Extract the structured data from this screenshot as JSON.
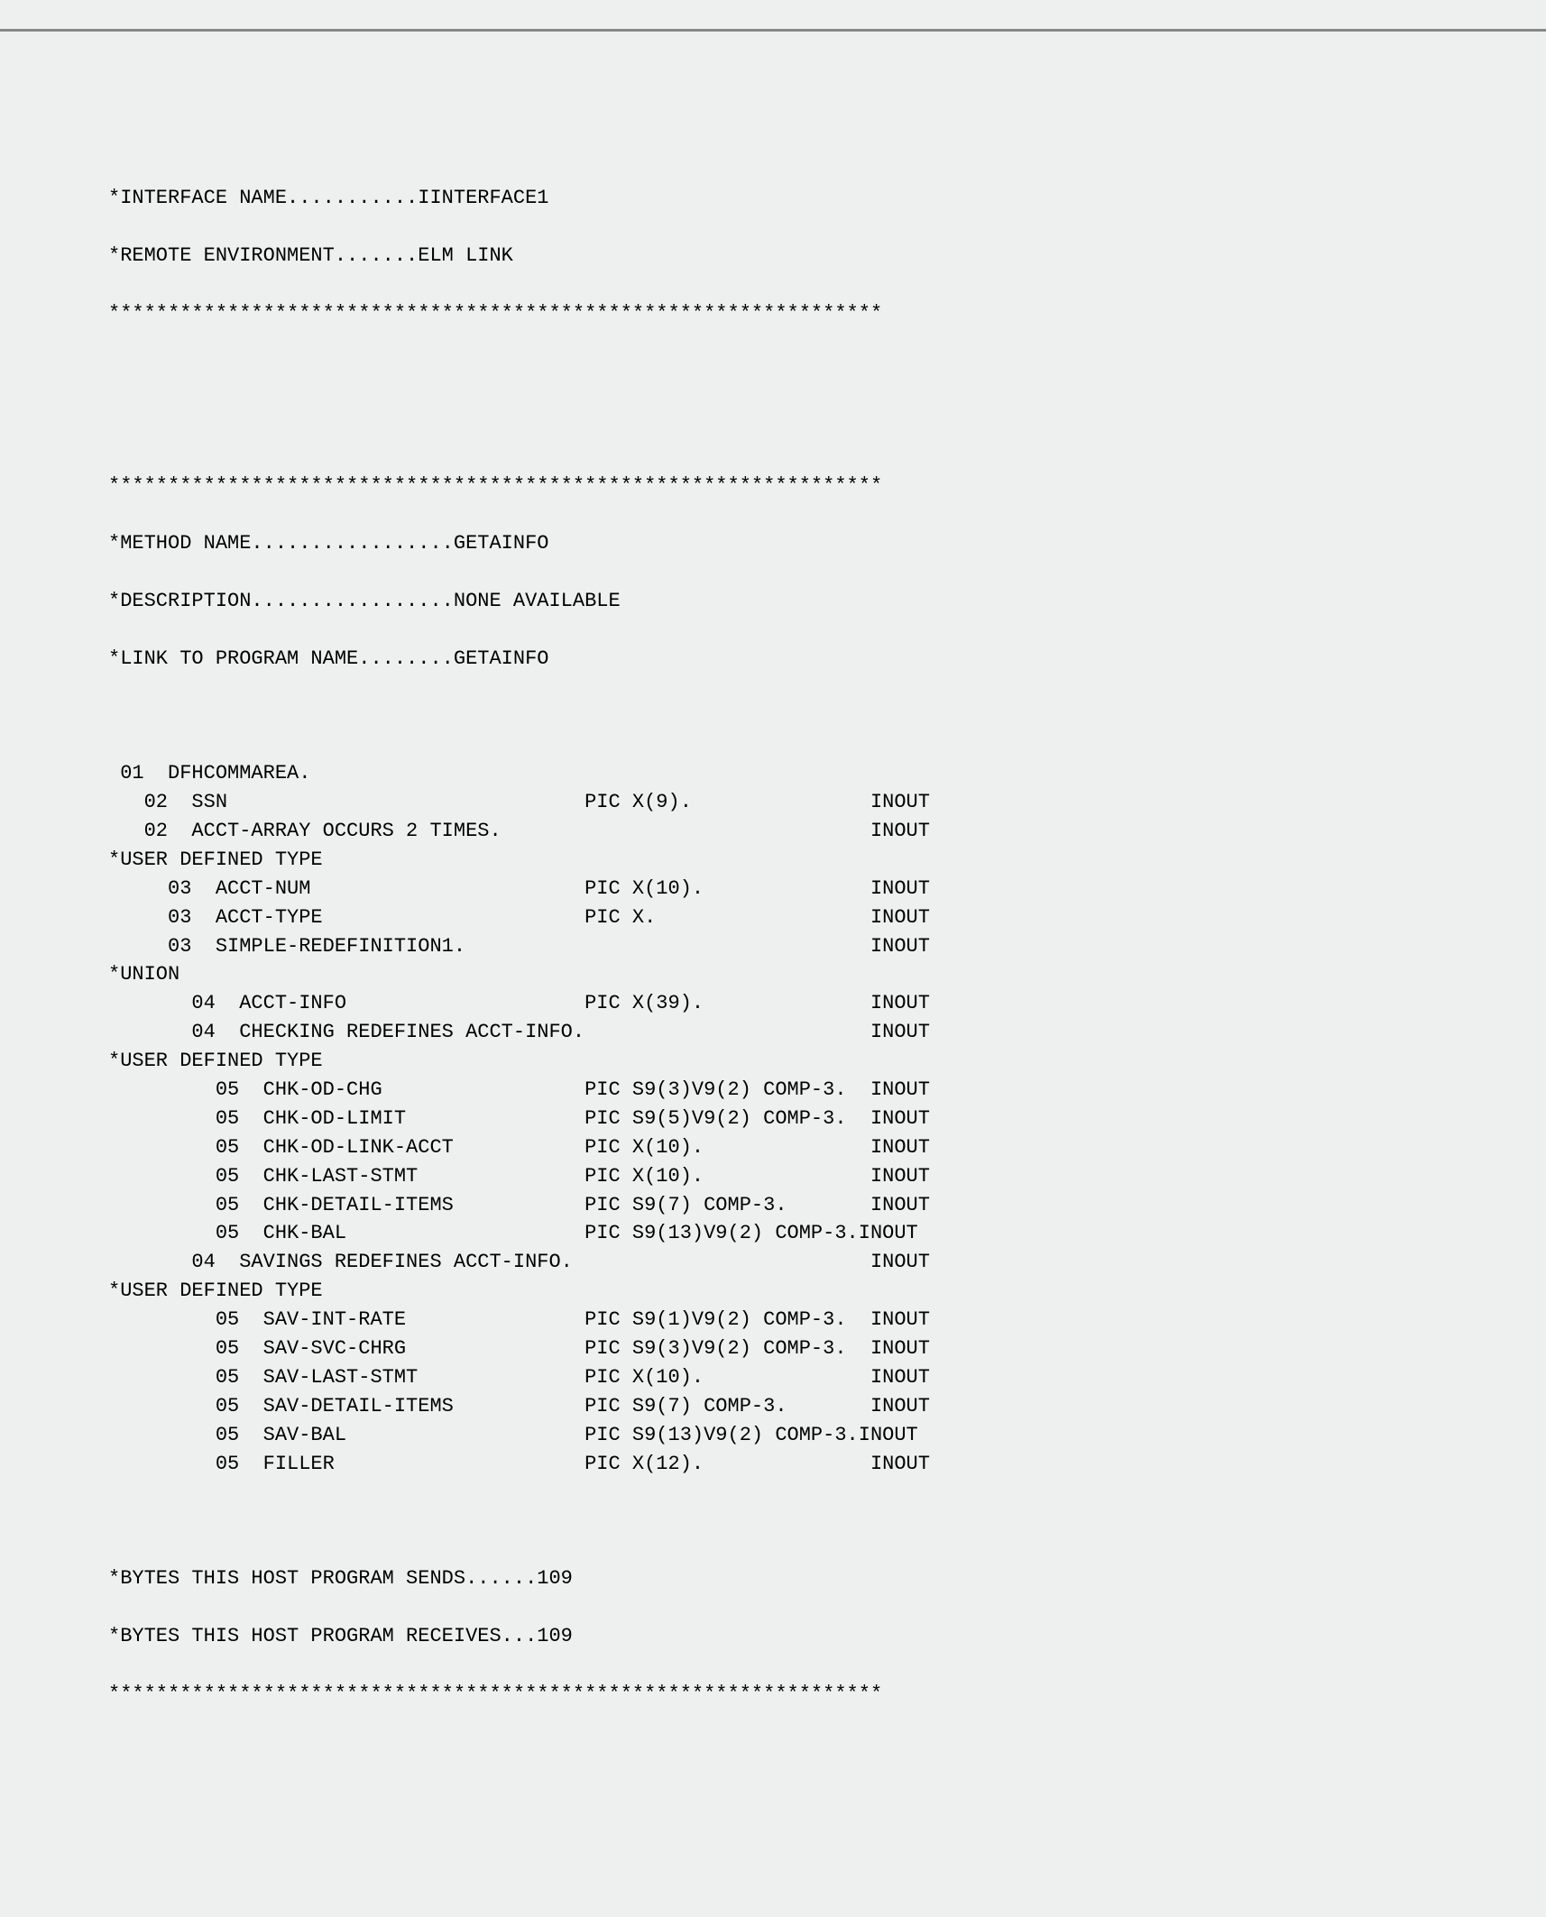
{
  "header": {
    "interface_name_label": "*INTERFACE NAME...........IINTERFACE1",
    "remote_env_label": "*REMOTE ENVIRONMENT.......ELM LINK",
    "stars": "*****************************************************************"
  },
  "method": {
    "stars": "*****************************************************************",
    "name": "*METHOD NAME.................GETAINFO",
    "description": "*DESCRIPTION.................NONE AVAILABLE",
    "link_to_program": "*LINK TO PROGRAM NAME........GETAINFO"
  },
  "rows": [
    {
      "ind": 0,
      "lvl": "01",
      "name": "DFHCOMMAREA.",
      "pic": "",
      "io": ""
    },
    {
      "ind": 1,
      "lvl": "02",
      "name": "SSN",
      "pic": "PIC X(9).",
      "io": "INOUT"
    },
    {
      "ind": 1,
      "lvl": "02",
      "name": "ACCT-ARRAY OCCURS 2 TIMES.",
      "pic": "",
      "io": "INOUT"
    },
    {
      "comment": "*USER DEFINED TYPE"
    },
    {
      "ind": 2,
      "lvl": "03",
      "name": "ACCT-NUM",
      "pic": "PIC X(10).",
      "io": "INOUT"
    },
    {
      "ind": 2,
      "lvl": "03",
      "name": "ACCT-TYPE",
      "pic": "PIC X.",
      "io": "INOUT"
    },
    {
      "ind": 2,
      "lvl": "03",
      "name": "SIMPLE-REDEFINITION1.",
      "pic": "",
      "io": "INOUT"
    },
    {
      "comment": "*UNION"
    },
    {
      "ind": 3,
      "lvl": "04",
      "name": "ACCT-INFO",
      "pic": "PIC X(39).",
      "io": "INOUT"
    },
    {
      "ind": 3,
      "lvl": "04",
      "name": "CHECKING REDEFINES ACCT-INFO.",
      "pic": "",
      "io": "INOUT"
    },
    {
      "comment": "*USER DEFINED TYPE"
    },
    {
      "ind": 4,
      "lvl": "05",
      "name": "CHK-OD-CHG",
      "pic": "PIC S9(3)V9(2) COMP-3.",
      "io": "INOUT"
    },
    {
      "ind": 4,
      "lvl": "05",
      "name": "CHK-OD-LIMIT",
      "pic": "PIC S9(5)V9(2) COMP-3.",
      "io": "INOUT"
    },
    {
      "ind": 4,
      "lvl": "05",
      "name": "CHK-OD-LINK-ACCT",
      "pic": "PIC X(10).",
      "io": "INOUT"
    },
    {
      "ind": 4,
      "lvl": "05",
      "name": "CHK-LAST-STMT",
      "pic": "PIC X(10).",
      "io": "INOUT"
    },
    {
      "ind": 4,
      "lvl": "05",
      "name": "CHK-DETAIL-ITEMS",
      "pic": "PIC S9(7) COMP-3.",
      "io": "INOUT"
    },
    {
      "ind": 4,
      "lvl": "05",
      "name": "CHK-BAL",
      "pic": "PIC S9(13)V9(2) COMP-3.",
      "io": "INOUT",
      "tight": true
    },
    {
      "ind": 3,
      "lvl": "04",
      "name": "SAVINGS REDEFINES ACCT-INFO.",
      "pic": "",
      "io": "INOUT"
    },
    {
      "comment": "*USER DEFINED TYPE"
    },
    {
      "ind": 4,
      "lvl": "05",
      "name": "SAV-INT-RATE",
      "pic": "PIC S9(1)V9(2) COMP-3.",
      "io": "INOUT"
    },
    {
      "ind": 4,
      "lvl": "05",
      "name": "SAV-SVC-CHRG",
      "pic": "PIC S9(3)V9(2) COMP-3.",
      "io": "INOUT"
    },
    {
      "ind": 4,
      "lvl": "05",
      "name": "SAV-LAST-STMT",
      "pic": "PIC X(10).",
      "io": "INOUT"
    },
    {
      "ind": 4,
      "lvl": "05",
      "name": "SAV-DETAIL-ITEMS",
      "pic": "PIC S9(7) COMP-3.",
      "io": "INOUT"
    },
    {
      "ind": 4,
      "lvl": "05",
      "name": "SAV-BAL",
      "pic": "PIC S9(13)V9(2) COMP-3.",
      "io": "INOUT",
      "tight": true
    },
    {
      "ind": 4,
      "lvl": "05",
      "name": "FILLER",
      "pic": "PIC X(12).",
      "io": "INOUT"
    }
  ],
  "footer": {
    "sends": "*BYTES THIS HOST PROGRAM SENDS......109",
    "receives": "*BYTES THIS HOST PROGRAM RECEIVES...109",
    "stars": "*****************************************************************"
  },
  "layout": {
    "base_indent_spaces": 1,
    "indent_step": 2,
    "lvl_width": 4,
    "pic_col": 40,
    "io_col": 64
  }
}
